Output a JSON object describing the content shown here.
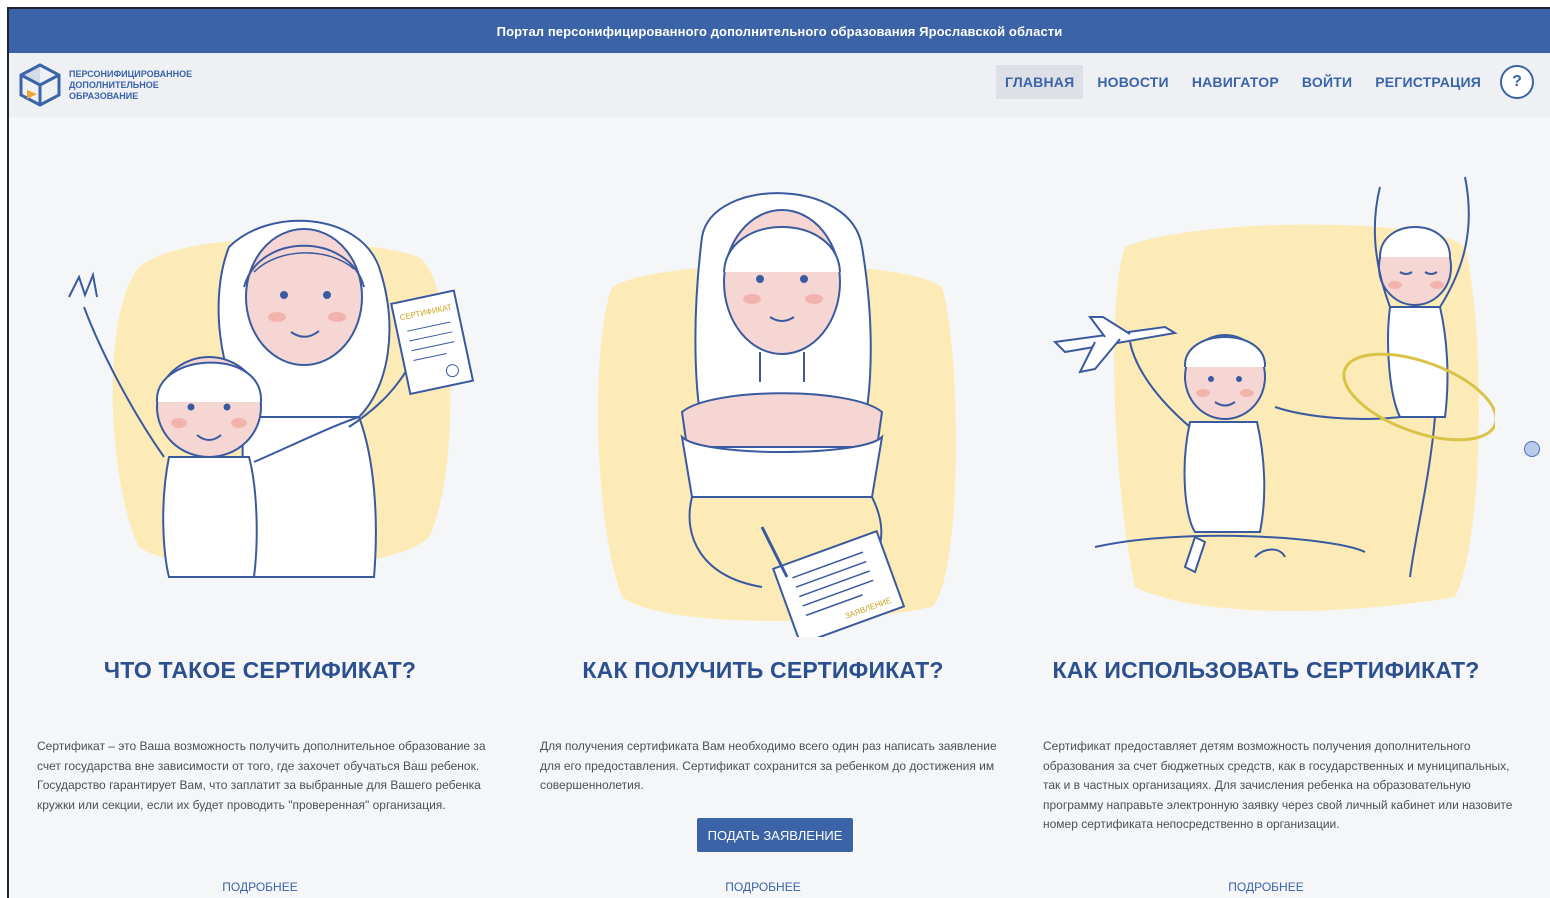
{
  "topbar": {
    "title": "Портал персонифицированного дополнительного образования Ярославской области"
  },
  "logo": {
    "lines": [
      "ПЕРСОНИФИЦИРОВАННОЕ",
      "ДОПОЛНИТЕЛЬНОЕ",
      "ОБРАЗОВАНИЕ"
    ]
  },
  "nav": {
    "items": [
      {
        "label": "ГЛАВНАЯ",
        "active": true
      },
      {
        "label": "НОВОСТИ"
      },
      {
        "label": "НАВИГАТОР"
      },
      {
        "label": "ВОЙТИ"
      },
      {
        "label": "РЕГИСТРАЦИЯ"
      }
    ],
    "help_label": "?"
  },
  "columns": [
    {
      "title": "ЧТО ТАКОЕ СЕРТИФИКАТ?",
      "description": "Сертификат – это Ваша возможность получить дополнительное образование за счет государства вне зависимости от того, где захочет обучаться Ваш ребенок. Государство гарантирует Вам, что заплатит за выбранные для Вашего ребенка кружки или секции, если их будет проводить \"проверенная\" организация.",
      "more_label": "ПОДРОБНЕЕ",
      "badge_text": "СЕРТИФИКАТ"
    },
    {
      "title": "КАК ПОЛУЧИТЬ СЕРТИФИКАТ?",
      "description": "Для получения сертификата Вам необходимо всего один раз написать заявление для его предоставления. Сертификат сохранится за ребенком до достижения им совершеннолетия.",
      "button_label": "ПОДАТЬ ЗАЯВЛЕНИЕ",
      "more_label": "ПОДРОБНЕЕ",
      "badge_text": "ЗАЯВЛЕНИЕ"
    },
    {
      "title": "КАК ИСПОЛЬЗОВАТЬ СЕРТИФИКАТ?",
      "description": "Сертификат предоставляет детям возможность получения дополнительного образования за счет бюджетных средств, как в государственных и муниципальных, так и в частных организациях. Для зачисления ребенка на образовательную программу направьте электронную заявку через свой личный кабинет или назовите номер сертификата непосредственно в организации.",
      "more_label": "ПОДРОБНЕЕ"
    }
  ],
  "colors": {
    "primary": "#3a63a8",
    "title": "#2c4f8f",
    "blob": "#fdebb7",
    "skin": "#f6d6d2"
  }
}
